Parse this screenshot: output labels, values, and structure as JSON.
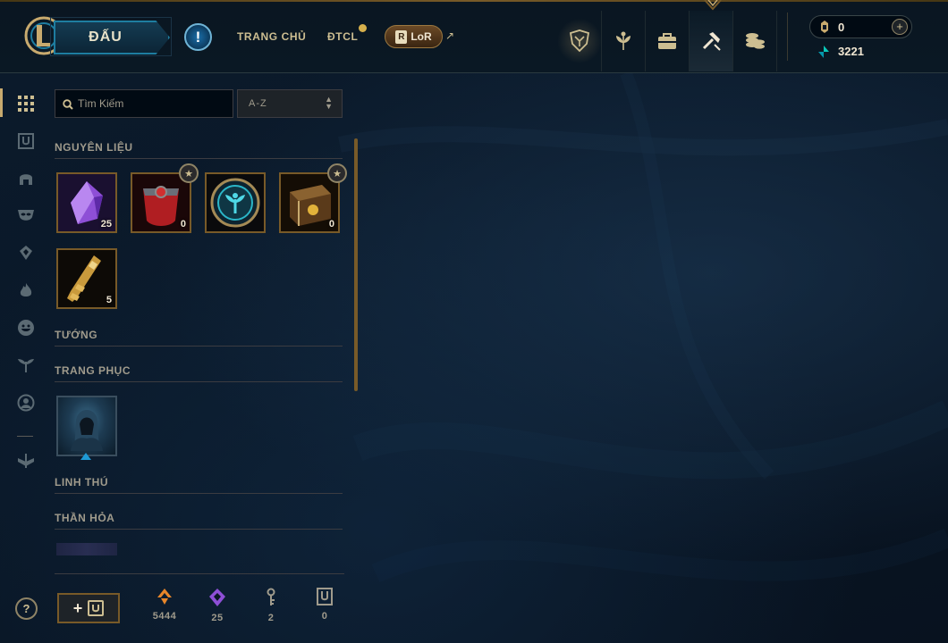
{
  "colors": {
    "gold": "#c8aa6e",
    "gold_dark": "#785a28",
    "text": "#a09b8c",
    "accent_blue": "#1e7da0",
    "background": "#010a13"
  },
  "header": {
    "play_label": "ĐẤU",
    "alert_icon": "exclamation-icon",
    "nav": {
      "home": "TRANG CHỦ",
      "tft": "ĐTCL",
      "lor": "LoR",
      "lor_badge": "R"
    },
    "tabs": [
      {
        "name": "profile",
        "icon": "crest-icon"
      },
      {
        "name": "collection",
        "icon": "laurel-icon"
      },
      {
        "name": "store-bag",
        "icon": "bag-icon"
      },
      {
        "name": "loot",
        "icon": "hammer-icon"
      },
      {
        "name": "store",
        "icon": "coins-icon"
      }
    ],
    "currency": {
      "rp": "0",
      "be": "3221",
      "add_label": "+"
    }
  },
  "sidebar": {
    "items": [
      {
        "name": "all",
        "icon": "grid-icon"
      },
      {
        "name": "chests",
        "icon": "chest-icon"
      },
      {
        "name": "champions",
        "icon": "helmet-icon"
      },
      {
        "name": "skins",
        "icon": "mask-icon"
      },
      {
        "name": "eternals",
        "icon": "ward-icon"
      },
      {
        "name": "emotes",
        "icon": "flame-icon"
      },
      {
        "name": "icons",
        "icon": "smiley-icon"
      },
      {
        "name": "ward",
        "icon": "tree-icon"
      },
      {
        "name": "summoner-icons",
        "icon": "person-circle-icon"
      },
      {
        "name": "other",
        "icon": "double-arrow-icon"
      }
    ],
    "help_label": "?"
  },
  "loot": {
    "search_placeholder": "Tìm Kiếm",
    "sort_label": "A-Z",
    "sections": {
      "materials": "NGUYÊN LIỆU",
      "champions": "TƯỚNG",
      "skins": "TRANG PHỤC",
      "companions": "LINH THÚ",
      "eternals": "THẦN HỎA"
    },
    "materials": [
      {
        "name": "gem",
        "count": "25"
      },
      {
        "name": "masterwork-chest",
        "count": "0"
      },
      {
        "name": "ward-token",
        "count": ""
      },
      {
        "name": "hextech-chest",
        "count": "0"
      },
      {
        "name": "key",
        "count": "5"
      }
    ]
  },
  "wallet": {
    "craft_plus": "+",
    "items": [
      {
        "name": "orange-essence",
        "value": "5444"
      },
      {
        "name": "gemstone",
        "value": "25"
      },
      {
        "name": "key-fragment",
        "value": "2"
      },
      {
        "name": "chest",
        "value": "0"
      }
    ]
  }
}
